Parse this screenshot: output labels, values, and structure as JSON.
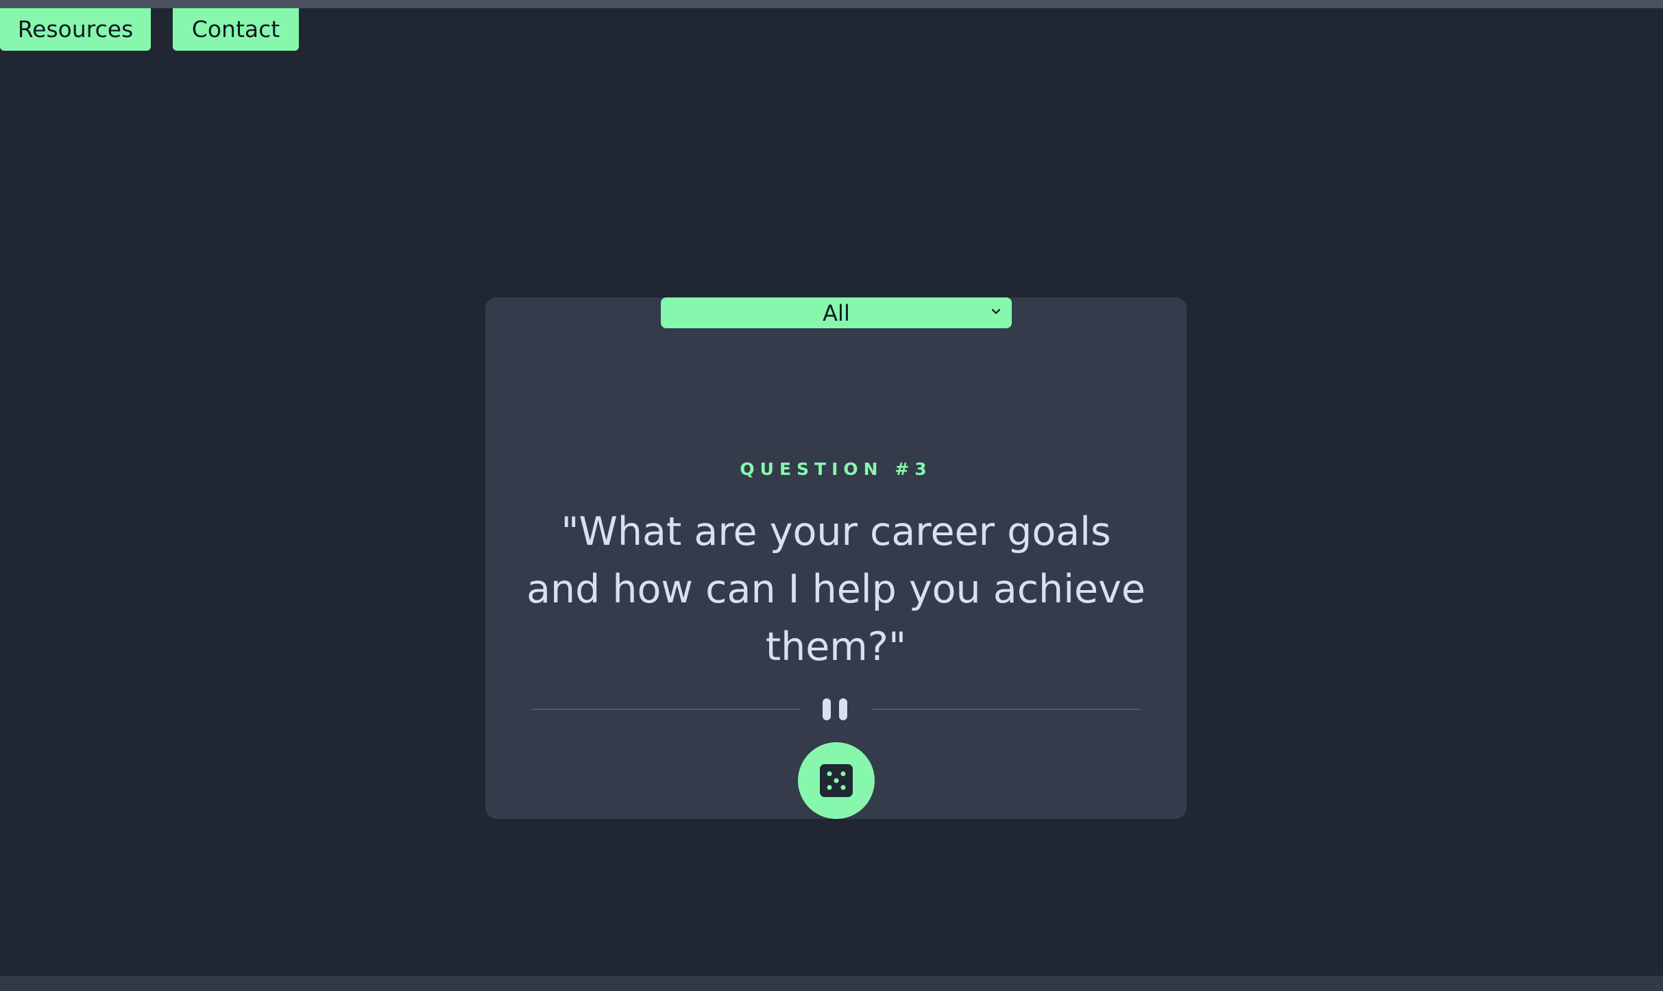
{
  "nav": {
    "resources_label": "Resources",
    "contact_label": "Contact"
  },
  "filter": {
    "selected": "All",
    "icon": "chevron-down-icon"
  },
  "question": {
    "label": "QUESTION #3",
    "text": "\"What are your career goals and how can I help you achieve them?\""
  },
  "divider": {
    "icon": "pause-icon"
  },
  "random_button": {
    "icon": "dice-icon"
  },
  "colors": {
    "background": "#202632",
    "card": "#343b4a",
    "accent": "#86f7ad",
    "text": "#d6e1f1"
  }
}
